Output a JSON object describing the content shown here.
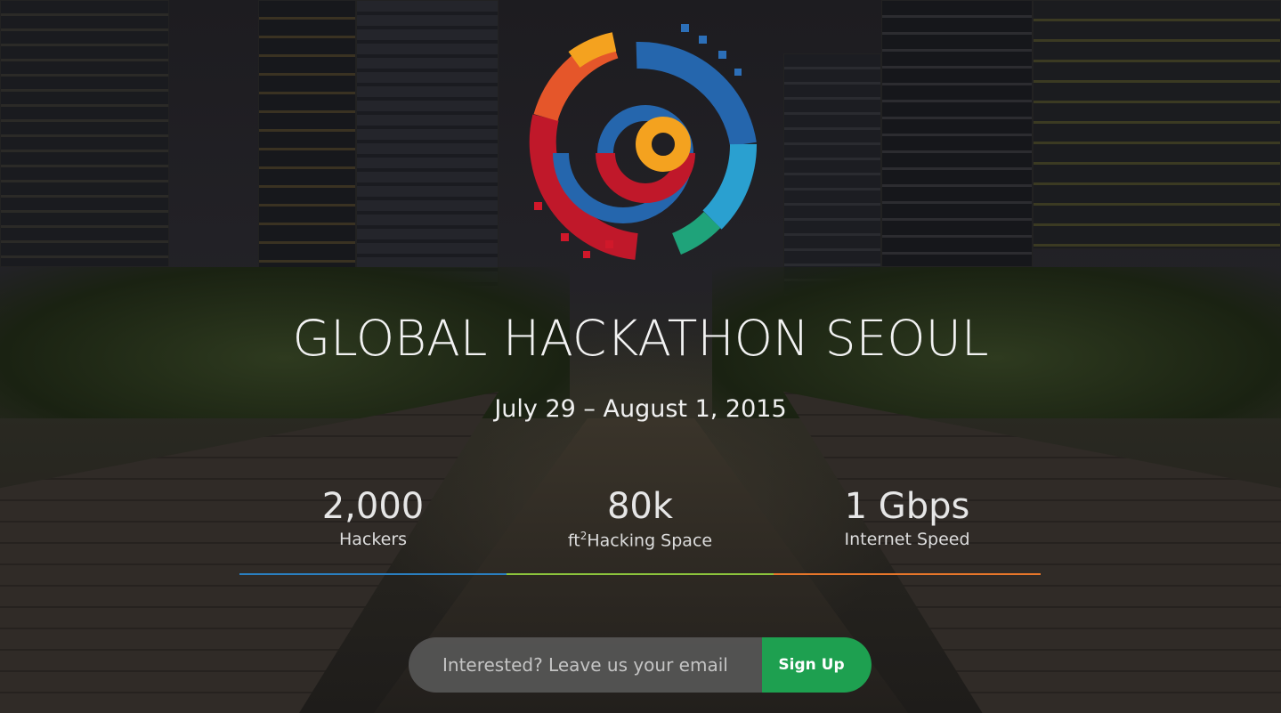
{
  "hero": {
    "title": "GLOBAL HACKATHON SEOUL",
    "date": "July 29 – August 1, 2015"
  },
  "stats": [
    {
      "value": "2,000",
      "label": "Hackers",
      "color": "#2a7fc0"
    },
    {
      "value": "80k",
      "unit": "ft",
      "sup": "2",
      "label": "Hacking Space",
      "color": "#8cc43c"
    },
    {
      "value": "1 Gbps",
      "label": "Internet Speed",
      "color": "#e8762a"
    }
  ],
  "signup": {
    "placeholder": "Interested? Leave us your email",
    "button": "Sign Up"
  }
}
